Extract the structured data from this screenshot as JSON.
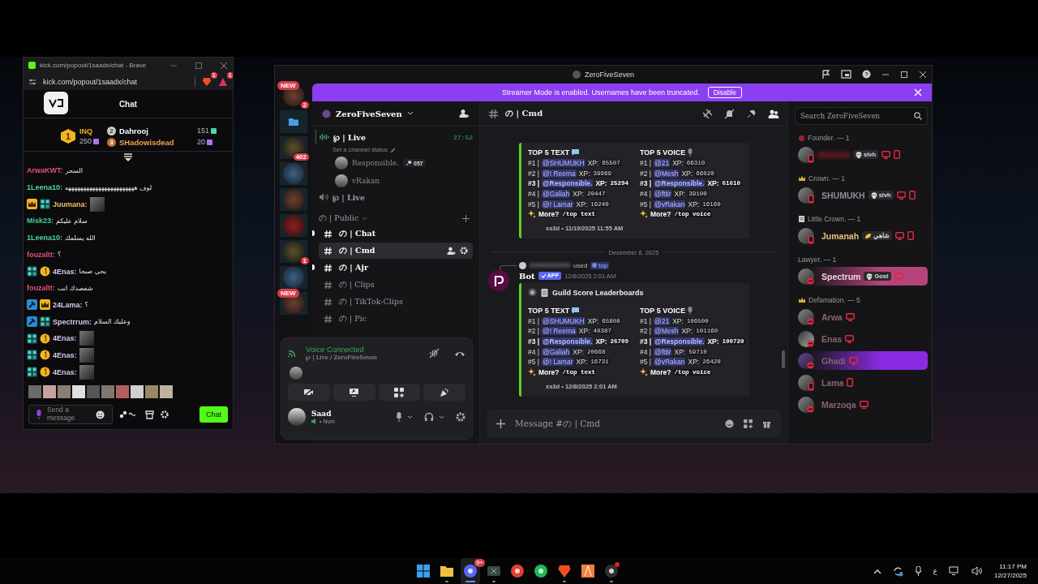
{
  "kick": {
    "window_title": "kick.com/popout/1saadx/chat - Brave",
    "url": "kick.com/popout/1saadx/chat",
    "brave_badges": [
      "1",
      "1"
    ],
    "header": "Chat",
    "top_gifter": {
      "rank": "1",
      "name": "INQ",
      "count": "250"
    },
    "gifters": [
      {
        "rank": "2",
        "name": "Dahrooj",
        "count": "151",
        "color": "#ffffff"
      },
      {
        "rank": "3",
        "name": "SHadowisdead",
        "count": "20",
        "color": "#f0a050"
      }
    ],
    "messages": [
      {
        "user": "ArwaKWT:",
        "color": "#e0507e",
        "kind": "text",
        "text": "السحر"
      },
      {
        "user": "1Leena10:",
        "color": "#4fd6a0",
        "kind": "text",
        "text": "لوف هههههههههههههههههههههههه"
      },
      {
        "user": "Juumana:",
        "color": "#e8c35a",
        "badges": [
          {
            "kind": "crown"
          },
          {
            "kind": "og"
          }
        ],
        "kind": "emote"
      },
      {
        "user": "Misk23:",
        "color": "#3fd49c",
        "kind": "text",
        "text": "سلام عليكم"
      },
      {
        "user": "1Leena10:",
        "color": "#4fd6a0",
        "kind": "text",
        "text": "الله يسلمك"
      },
      {
        "user": "fouzaltt:",
        "color": "#e0507e",
        "kind": "text",
        "text": "؟"
      },
      {
        "user": "4Enas:",
        "color": "#d8c8f0",
        "badges": [
          {
            "kind": "og"
          },
          {
            "kind": "sub"
          }
        ],
        "kind": "text",
        "text": "يحي صبحا"
      },
      {
        "user": "fouzaltt:",
        "color": "#e0507e",
        "kind": "text",
        "text": "شفصدك انت"
      },
      {
        "user": "24Lama:",
        "color": "#d8c8f0",
        "badges": [
          {
            "kind": "mod"
          },
          {
            "kind": "crown"
          }
        ],
        "kind": "text",
        "text": "؟"
      },
      {
        "user": "Spectrrum:",
        "color": "#d8c8f0",
        "badges": [
          {
            "kind": "mod"
          },
          {
            "kind": "og"
          }
        ],
        "kind": "text",
        "text": "وعليك السلام"
      },
      {
        "user": "4Enas:",
        "color": "#d8c8f0",
        "badges": [
          {
            "kind": "og"
          },
          {
            "kind": "sub"
          }
        ],
        "kind": "emote"
      },
      {
        "user": "4Enas:",
        "color": "#d8c8f0",
        "badges": [
          {
            "kind": "og"
          },
          {
            "kind": "sub"
          }
        ],
        "kind": "emote"
      },
      {
        "user": "4Enas:",
        "color": "#d8c8f0",
        "badges": [
          {
            "kind": "og"
          },
          {
            "kind": "sub"
          }
        ],
        "kind": "emote"
      }
    ],
    "input_placeholder": "Send a message",
    "send_label": "Chat"
  },
  "discord": {
    "title": "ZeroFiveSeven",
    "banner": {
      "text": "Streamer Mode is enabled. Usernames have been truncated.",
      "button": "Disable"
    },
    "servers": [
      {
        "kind": "server",
        "pill": "NEW",
        "count": "2",
        "in_folder": false
      },
      {
        "kind": "folder",
        "in_folder": true
      },
      {
        "kind": "server",
        "count": "402",
        "in_folder": true
      },
      {
        "kind": "server",
        "in_folder": true
      },
      {
        "kind": "server",
        "in_folder": true
      },
      {
        "kind": "server",
        "in_folder": true
      },
      {
        "kind": "server",
        "count": "1",
        "in_folder": true
      },
      {
        "kind": "server",
        "in_folder": true
      },
      {
        "kind": "server",
        "pill": "NEW",
        "in_folder": true
      }
    ],
    "guild_name": "ZeroFiveSeven",
    "channels": [
      {
        "kind": "voice",
        "name": "℘ | Live",
        "timer": "27:52",
        "status_hint": "Set a channel status",
        "members": [
          {
            "name": "Responsible.",
            "tag": "057"
          },
          {
            "name": "vRakan"
          }
        ]
      },
      {
        "kind": "voice",
        "name": "℘ | Live"
      },
      {
        "kind": "category",
        "name": "の | Public"
      },
      {
        "kind": "text",
        "name": "の | Chat",
        "unread": true,
        "selected": false
      },
      {
        "kind": "text",
        "name": "の | Cmd",
        "unread": false,
        "selected": true
      },
      {
        "kind": "text",
        "name": "の | Ajr",
        "unread": true,
        "selected": false
      },
      {
        "kind": "text",
        "name": "の | Clips",
        "unread": false,
        "selected": false
      },
      {
        "kind": "text",
        "name": "の | TikTok-Clips",
        "unread": false,
        "selected": false
      },
      {
        "kind": "text",
        "name": "の | Pic",
        "unread": false,
        "selected": false
      }
    ],
    "voice_panel": {
      "title": "Voice Connected",
      "location": "℘ | Live / ZeroFiveSeven"
    },
    "user": {
      "name": "Saad",
      "status": "• Nvm"
    },
    "channel_header": "の | Cmd",
    "messages": [
      {
        "kind": "embed",
        "embed": {
          "columns": [
            {
              "kind": "text",
              "heading": "TOP 5 TEXT",
              "rows": [
                {
                  "rank": "#1 |",
                  "user": "@SHUMUKH",
                  "label": "XP:",
                  "xp": "65507",
                  "bold": false
                },
                {
                  "rank": "#2 |",
                  "user": "@! Reema",
                  "label": "XP:",
                  "xp": "39969",
                  "bold": false
                },
                {
                  "rank": "#3 |",
                  "user": "@Responsible.",
                  "label": "XP:",
                  "xp": "25294",
                  "bold": true
                },
                {
                  "rank": "#4 |",
                  "user": "@Galiah",
                  "label": "XP:",
                  "xp": "20447",
                  "bold": false
                },
                {
                  "rank": "#5 |",
                  "user": "@! Lamar",
                  "label": "XP:",
                  "xp": "16240",
                  "bold": false
                }
              ],
              "more": "More?",
              "command": "/top text"
            },
            {
              "kind": "voice",
              "heading": "TOP 5 VOICE",
              "rows": [
                {
                  "rank": "#1 |",
                  "user": "@21",
                  "label": "XP:",
                  "xp": "66310",
                  "bold": false
                },
                {
                  "rank": "#2 |",
                  "user": "@Mesh",
                  "label": "XP:",
                  "xp": "66020",
                  "bold": false
                },
                {
                  "rank": "#3 |",
                  "user": "@Responsible.",
                  "label": "XP:",
                  "xp": "61610",
                  "bold": true
                },
                {
                  "rank": "#4 |",
                  "user": "@fttir",
                  "label": "XP:",
                  "xp": "39100",
                  "bold": false
                },
                {
                  "rank": "#5 |",
                  "user": "@vRakan",
                  "label": "XP:",
                  "xp": "16160",
                  "bold": false
                }
              ],
              "more": "More?",
              "command": "/top voice"
            }
          ],
          "footer": "xs3d • 11/19/2025 11:55 AM"
        }
      },
      {
        "kind": "divider",
        "text": "December 8, 2025"
      },
      {
        "kind": "bot",
        "reply_used": "used",
        "reply_command": "top",
        "author": "Bot",
        "tag": "APP",
        "time": "12/8/2025 2:01 AM",
        "embed": {
          "title": "Guild Score Leaderboards",
          "columns": [
            {
              "kind": "text",
              "heading": "TOP 5 TEXT",
              "rows": [
                {
                  "rank": "#1 |",
                  "user": "@SHUMUKH",
                  "label": "XP:",
                  "xp": "65808",
                  "bold": false
                },
                {
                  "rank": "#2 |",
                  "user": "@! Reema",
                  "label": "XP:",
                  "xp": "40387",
                  "bold": false
                },
                {
                  "rank": "#3 |",
                  "user": "@Responsible.",
                  "label": "XP:",
                  "xp": "26709",
                  "bold": true
                },
                {
                  "rank": "#4 |",
                  "user": "@Galiah",
                  "label": "XP:",
                  "xp": "20668",
                  "bold": false
                },
                {
                  "rank": "#5 |",
                  "user": "@! Lamar",
                  "label": "XP:",
                  "xp": "16731",
                  "bold": false
                }
              ],
              "more": "More?",
              "command": "/top text"
            },
            {
              "kind": "voice",
              "heading": "TOP 5 VOICE",
              "rows": [
                {
                  "rank": "#1 |",
                  "user": "@21",
                  "label": "XP:",
                  "xp": "106500",
                  "bold": false
                },
                {
                  "rank": "#2 |",
                  "user": "@Mesh",
                  "label": "XP:",
                  "xp": "101160",
                  "bold": false
                },
                {
                  "rank": "#3 |",
                  "user": "@Responsible.",
                  "label": "XP:",
                  "xp": "100720",
                  "bold": true
                },
                {
                  "rank": "#4 |",
                  "user": "@fttir",
                  "label": "XP:",
                  "xp": "59710",
                  "bold": false
                },
                {
                  "rank": "#5 |",
                  "user": "@vRakan",
                  "label": "XP:",
                  "xp": "26420",
                  "bold": false
                }
              ],
              "more": "More?",
              "command": "/top voice"
            }
          ],
          "footer": "xs3d • 12/8/2025 2:01 AM"
        }
      }
    ],
    "composer_placeholder": "Message #の | Cmd",
    "search_placeholder": "Search ZeroFiveSeven",
    "member_groups": [
      {
        "name": "Founder. — 1",
        "members": [
          {
            "name_hidden": true,
            "status": {
              "kind": "mobile"
            },
            "tag": {
              "kind": "skull",
              "text": "slvh"
            },
            "devices": [
              {
                "kind": "desktop"
              },
              {
                "kind": "mobile"
              }
            ]
          }
        ]
      },
      {
        "name": "Crown. — 1",
        "members": [
          {
            "name": "SHUMUKH",
            "color": "#8e8e96",
            "status": {
              "kind": "mobile"
            },
            "tag": {
              "kind": "skull",
              "text": "slvh"
            },
            "devices": [
              {
                "kind": "desktop"
              },
              {
                "kind": "mobile"
              }
            ]
          }
        ]
      },
      {
        "name": "Little Crown. — 1",
        "members": [
          {
            "name": "Jumanah",
            "color": "#e2c27a",
            "status": {
              "kind": "mobile"
            },
            "tag": {
              "kind": "leaf",
              "text": "شاهي"
            },
            "devices": [
              {
                "kind": "desktop"
              },
              {
                "kind": "mobile"
              }
            ]
          }
        ]
      },
      {
        "name": "Lawyer. — 1",
        "members": [
          {
            "name": "Spectrum",
            "color": "#ecd2e0",
            "status": {
              "kind": "dnd"
            },
            "tag": {
              "kind": "skull",
              "text": "Gost"
            },
            "devices": [
              {
                "kind": "desktop"
              }
            ],
            "nameplate": {
              "color": "#b4457a"
            }
          }
        ]
      },
      {
        "name": "Defamation. — 5",
        "members": [
          {
            "name": "Arwa",
            "color": "#8a6470",
            "status": {
              "kind": "dnd"
            },
            "devices": [
              {
                "kind": "desktop"
              }
            ]
          },
          {
            "name": "Enas",
            "color": "#8a6470",
            "status": {
              "kind": "dnd"
            },
            "devices": [
              {
                "kind": "desktop"
              }
            ]
          },
          {
            "name": "Ghadi",
            "color": "#8a6470",
            "status": {
              "kind": "dnd"
            },
            "devices": [
              {
                "kind": "desktop"
              }
            ],
            "nameplate": {
              "color": "#8a2be2"
            }
          },
          {
            "name": "Lama",
            "color": "#8a6470",
            "status": {
              "kind": "mobile"
            },
            "devices": [
              {
                "kind": "mobile"
              }
            ]
          },
          {
            "name": "Marzoqa",
            "color": "#8a6470",
            "status": {
              "kind": "dnd"
            },
            "devices": [
              {
                "kind": "desktop"
              }
            ]
          }
        ]
      }
    ]
  },
  "taskbar": {
    "apps": [
      {
        "kind": "start",
        "running": false,
        "active": false
      },
      {
        "kind": "folder",
        "running": true,
        "active": false
      },
      {
        "kind": "discord",
        "running": true,
        "active": true,
        "badge": "9+"
      },
      {
        "kind": "terminal",
        "running": true,
        "active": false
      },
      {
        "kind": "chrome",
        "running": false,
        "active": false
      },
      {
        "kind": "spotify",
        "running": false,
        "active": false
      },
      {
        "kind": "brave",
        "running": true,
        "active": false
      },
      {
        "kind": "editor",
        "running": false,
        "active": false
      },
      {
        "kind": "obs",
        "running": true,
        "active": false,
        "alert": true
      }
    ],
    "language": "ع",
    "time": "11:17 PM",
    "date": "12/27/2025"
  }
}
